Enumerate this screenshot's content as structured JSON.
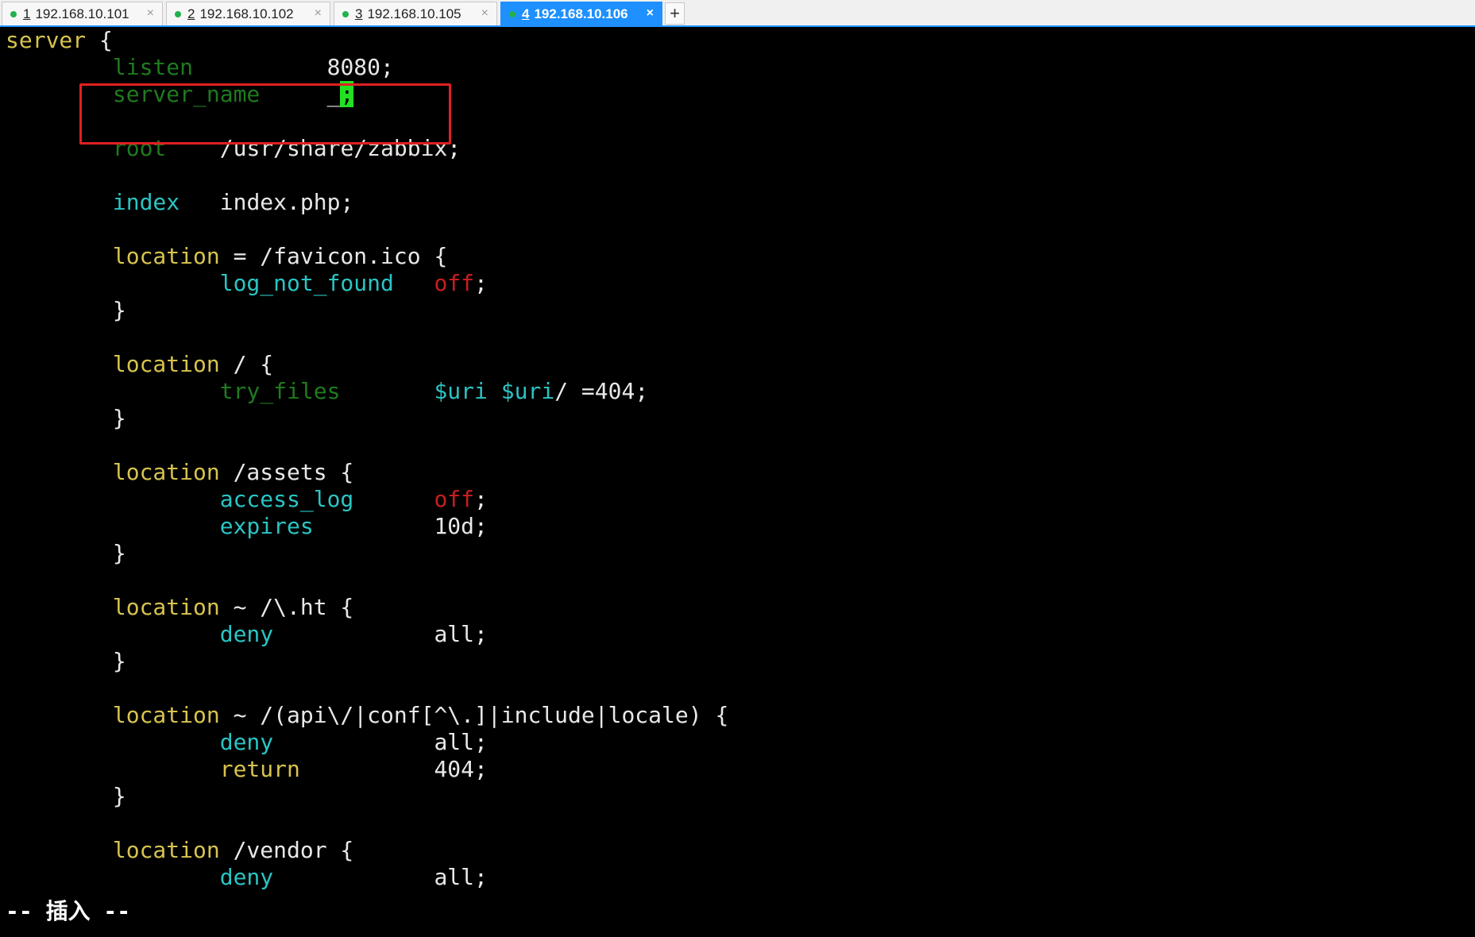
{
  "tabs": [
    {
      "num": "1",
      "host": "192.168.10.101",
      "active": false
    },
    {
      "num": "2",
      "host": "192.168.10.102",
      "active": false
    },
    {
      "num": "3",
      "host": "192.168.10.105",
      "active": false
    },
    {
      "num": "4",
      "host": "192.168.10.106",
      "active": true
    }
  ],
  "close_glyph": "×",
  "new_tab_glyph": "+",
  "editor": {
    "l1": {
      "kw": "server",
      "rest": " {"
    },
    "l2": {
      "kw": "listen",
      "pad": "          ",
      "val": "8080;"
    },
    "l3": {
      "kw": "server_name",
      "pad": "     ",
      "val": "_",
      "cursor": ";"
    },
    "l5": {
      "kw": "root",
      "pad": "    ",
      "val": "/usr/share/zabbix;"
    },
    "l7": {
      "kw": "index",
      "pad": "   ",
      "val": "index.php;"
    },
    "l9": {
      "kw": "location",
      "rest": " = /favicon.ico {"
    },
    "l10": {
      "kw": "log_not_found",
      "pad": "   ",
      "off": "off",
      "semi": ";"
    },
    "l11": "}",
    "l13": {
      "kw": "location",
      "rest": " / {"
    },
    "l14": {
      "kw": "try_files",
      "pad": "       ",
      "v1": "$uri",
      "sp": " ",
      "v2": "$uri",
      "rest": "/ =404;"
    },
    "l15": "}",
    "l17": {
      "kw": "location",
      "rest": " /assets {"
    },
    "l18": {
      "kw": "access_log",
      "pad": "      ",
      "off": "off",
      "semi": ";"
    },
    "l19": {
      "kw": "expires",
      "pad": "         ",
      "val": "10d;"
    },
    "l20": "}",
    "l22": {
      "kw": "location",
      "rest": " ~ /\\.ht {"
    },
    "l23": {
      "kw": "deny",
      "pad": "            ",
      "val": "all;"
    },
    "l24": "}",
    "l26": {
      "kw": "location",
      "rest": " ~ /(api\\/|conf[^\\.]|include|locale) {"
    },
    "l27": {
      "kw": "deny",
      "pad": "            ",
      "val": "all;"
    },
    "l28": {
      "kw": "return",
      "pad": "          ",
      "val": "404;"
    },
    "l29": "}",
    "l31": {
      "kw": "location",
      "rest": " /vendor {"
    },
    "l32": {
      "kw": "deny",
      "pad": "            ",
      "val": "all;"
    }
  },
  "status_line": "-- 插入 --",
  "colors": {
    "tab_active": "#1e90ff",
    "keyword_yellow": "#d7c34f",
    "keyword_green": "#1f7a1f",
    "keyword_cyan": "#2bc4c4",
    "value_red": "#c81e1e",
    "cursor_green": "#22e022",
    "highlight_box": "#e02020"
  }
}
